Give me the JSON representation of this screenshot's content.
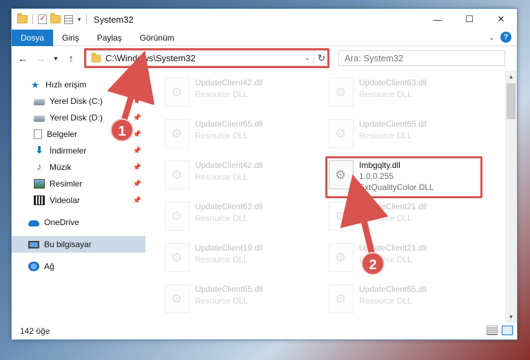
{
  "window": {
    "title": "System32",
    "controls": {
      "minimize": "—",
      "maximize": "☐",
      "close": "✕"
    }
  },
  "ribbon": {
    "tabs": [
      {
        "label": "Dosya",
        "active": true
      },
      {
        "label": "Giriş",
        "active": false
      },
      {
        "label": "Paylaş",
        "active": false
      },
      {
        "label": "Görünüm",
        "active": false
      }
    ],
    "help": "?"
  },
  "address": {
    "path": "C:\\Windows\\System32",
    "refresh_icon": "↻"
  },
  "search": {
    "placeholder": "Ara: System32"
  },
  "sidebar": {
    "items": [
      {
        "label": "Hızlı erişim",
        "icon": "star-icon"
      },
      {
        "label": "Yerel Disk (C:)",
        "icon": "disk-icon",
        "pinned": true
      },
      {
        "label": "Yerel Disk (D:)",
        "icon": "disk-icon",
        "pinned": true
      },
      {
        "label": "Belgeler",
        "icon": "documents-icon",
        "pinned": true
      },
      {
        "label": "İndirmeler",
        "icon": "downloads-icon",
        "pinned": true
      },
      {
        "label": "Müzik",
        "icon": "music-icon",
        "pinned": true
      },
      {
        "label": "Resimler",
        "icon": "pictures-icon",
        "pinned": true
      },
      {
        "label": "Videolar",
        "icon": "videos-icon",
        "pinned": true
      },
      {
        "label": "OneDrive",
        "icon": "onedrive-icon"
      },
      {
        "label": "Bu bilgisayar",
        "icon": "computer-icon",
        "selected": true
      },
      {
        "label": "Ağ",
        "icon": "network-icon"
      }
    ]
  },
  "files": {
    "left": [
      {
        "name": "UpdateClient42.dll",
        "type": "Resource DLL"
      },
      {
        "name": "UpdateClient65.dll",
        "type": "Resource DLL"
      },
      {
        "name": "UpdateClient42.dll",
        "type": "Resource DLL"
      },
      {
        "name": "UpdateClient63.dll",
        "type": "Resource DLL"
      },
      {
        "name": "UpdateClient19.dll",
        "type": "Resource DLL"
      },
      {
        "name": "UpdateClient65.dll",
        "type": "Resource DLL"
      }
    ],
    "right": [
      {
        "name": "UpdateClient63.dll",
        "type": "Resource DLL"
      },
      {
        "name": "UpdateClient65.dll",
        "type": "Resource DLL"
      },
      {
        "name": "Imbgqlty.dll",
        "version": "1.0.0.255",
        "type": "ExtQualityColor DLL",
        "highlighted": true
      },
      {
        "name": "UpdateClient21.dll",
        "type": "Resource DLL"
      },
      {
        "name": "UpdateClient21.dll",
        "type": "Resource DLL"
      },
      {
        "name": "UpdateClient65.dll",
        "type": "Resource DLL"
      }
    ]
  },
  "status": {
    "item_count": "142 öğe"
  },
  "callouts": {
    "step1": "1",
    "step2": "2"
  },
  "colors": {
    "accent": "#1979ca",
    "highlight": "#d9534f"
  }
}
